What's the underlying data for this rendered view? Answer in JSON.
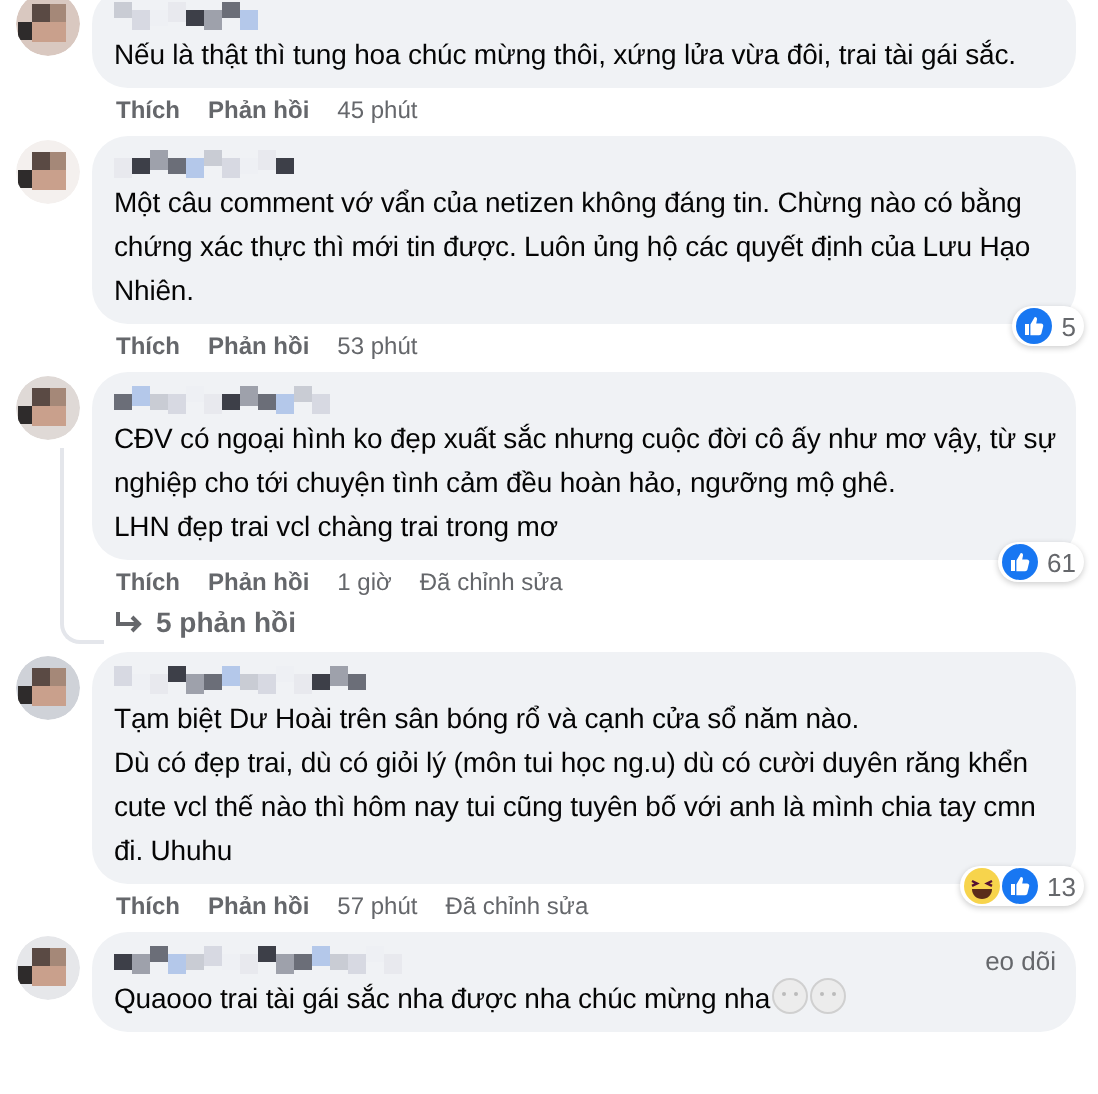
{
  "comments": [
    {
      "text": "Nếu là thật thì tung hoa chúc mừng thôi, xứng lửa vừa đôi, trai tài gái sắc.",
      "actions": [
        "Thích",
        "Phản hồi"
      ],
      "time": "45 phút"
    },
    {
      "text": "Một câu comment vớ vẩn của netizen không đáng tin. Chừng nào có bằng chứng xác thực thì mới tin được. Luôn ủng hộ các quyết định của Lưu Hạo Nhiên.",
      "actions": [
        "Thích",
        "Phản hồi"
      ],
      "time": "53 phút",
      "reactions": {
        "icons": [
          {
            "kind": "like"
          }
        ],
        "count": "5"
      }
    },
    {
      "text": "CĐV có ngoại hình ko đẹp xuất sắc nhưng cuộc đời cô ấy như mơ vậy, từ sự nghiệp cho tới chuyện tình cảm đều hoàn hảo, ngưỡng mộ ghê.\nLHN đẹp trai vcl chàng trai trong mơ",
      "actions": [
        "Thích",
        "Phản hồi"
      ],
      "time": "1 giờ",
      "edited": "Đã chỉnh sửa",
      "reactions": {
        "icons": [
          {
            "kind": "like"
          }
        ],
        "count": "61"
      },
      "replies": "5 phản hồi"
    },
    {
      "text": "Tạm biệt Dư Hoài trên sân bóng rổ và cạnh cửa sổ năm nào.\nDù có đẹp trai, dù có giỏi lý (môn tui học ng.u) dù có cười duyên răng khển cute vcl thế nào thì hôm nay tui cũng tuyên bố với anh là mình chia tay cmn đi. Uhuhu",
      "actions": [
        "Thích",
        "Phản hồi"
      ],
      "time": "57 phút",
      "edited": "Đã chỉnh sửa",
      "reactions": {
        "icons": [
          {
            "kind": "haha"
          },
          {
            "kind": "like"
          }
        ],
        "count": "13"
      }
    },
    {
      "follow": "eo dõi",
      "text": "Quaooo trai tài gái sắc nha được nha chúc mừng nha",
      "emojis": [
        {
          "kind": "neutral"
        },
        {
          "kind": "neutral"
        }
      ]
    }
  ]
}
